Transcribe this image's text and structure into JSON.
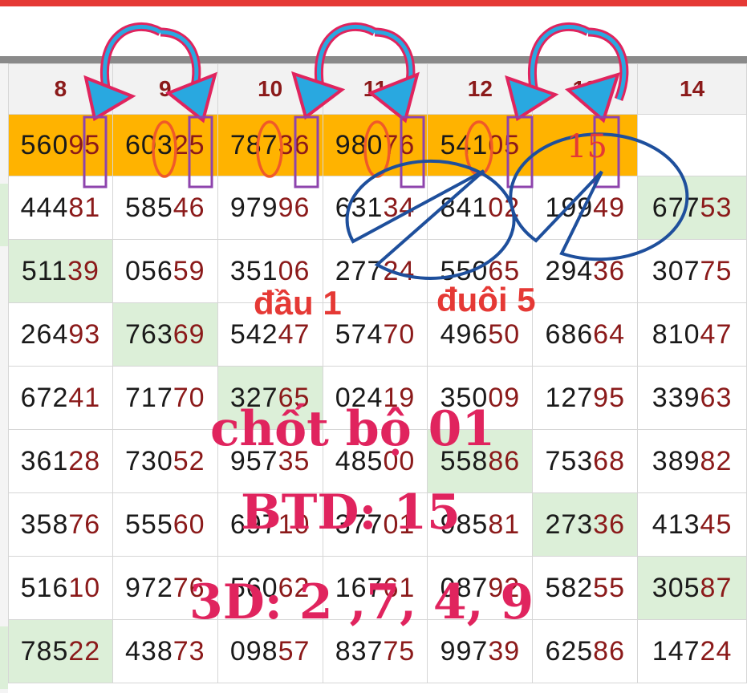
{
  "columns": [
    "8",
    "9",
    "10",
    "11",
    "12",
    "13",
    "14"
  ],
  "prize_row": [
    {
      "head": "560",
      "tail": "95"
    },
    {
      "head": "603",
      "tail": "25"
    },
    {
      "head": "787",
      "tail": "36"
    },
    {
      "head": "980",
      "tail": "76"
    },
    {
      "head": "541",
      "tail": "05"
    },
    {
      "head": "",
      "tail": ""
    },
    {
      "head": "",
      "tail": ""
    }
  ],
  "rows": [
    [
      {
        "head": "444",
        "tail": "81"
      },
      {
        "head": "585",
        "tail": "46"
      },
      {
        "head": "979",
        "tail": "96"
      },
      {
        "head": "631",
        "tail": "34"
      },
      {
        "head": "841",
        "tail": "02"
      },
      {
        "head": "199",
        "tail": "49"
      },
      {
        "head": "677",
        "tail": "53"
      }
    ],
    [
      {
        "head": "511",
        "tail": "39"
      },
      {
        "head": "056",
        "tail": "59"
      },
      {
        "head": "351",
        "tail": "06"
      },
      {
        "head": "277",
        "tail": "24"
      },
      {
        "head": "550",
        "tail": "65"
      },
      {
        "head": "294",
        "tail": "36"
      },
      {
        "head": "307",
        "tail": "75"
      }
    ],
    [
      {
        "head": "264",
        "tail": "93"
      },
      {
        "head": "763",
        "tail": "69"
      },
      {
        "head": "542",
        "tail": "47"
      },
      {
        "head": "574",
        "tail": "70"
      },
      {
        "head": "496",
        "tail": "50"
      },
      {
        "head": "686",
        "tail": "64"
      },
      {
        "head": "810",
        "tail": "47"
      }
    ],
    [
      {
        "head": "672",
        "tail": "41"
      },
      {
        "head": "717",
        "tail": "70"
      },
      {
        "head": "327",
        "tail": "65"
      },
      {
        "head": "024",
        "tail": "19"
      },
      {
        "head": "350",
        "tail": "09"
      },
      {
        "head": "127",
        "tail": "95"
      },
      {
        "head": "339",
        "tail": "63"
      }
    ],
    [
      {
        "head": "361",
        "tail": "28"
      },
      {
        "head": "730",
        "tail": "52"
      },
      {
        "head": "957",
        "tail": "35"
      },
      {
        "head": "485",
        "tail": "00"
      },
      {
        "head": "558",
        "tail": "86"
      },
      {
        "head": "753",
        "tail": "68"
      },
      {
        "head": "389",
        "tail": "82"
      }
    ],
    [
      {
        "head": "358",
        "tail": "76"
      },
      {
        "head": "555",
        "tail": "60"
      },
      {
        "head": "697",
        "tail": "10"
      },
      {
        "head": "377",
        "tail": "01"
      },
      {
        "head": "985",
        "tail": "81"
      },
      {
        "head": "273",
        "tail": "36"
      },
      {
        "head": "413",
        "tail": "45"
      }
    ],
    [
      {
        "head": "516",
        "tail": "10"
      },
      {
        "head": "972",
        "tail": "76"
      },
      {
        "head": "560",
        "tail": "62"
      },
      {
        "head": "167",
        "tail": "61"
      },
      {
        "head": "087",
        "tail": "92"
      },
      {
        "head": "582",
        "tail": "55"
      },
      {
        "head": "305",
        "tail": "87"
      }
    ],
    [
      {
        "head": "785",
        "tail": "22"
      },
      {
        "head": "438",
        "tail": "73"
      },
      {
        "head": "098",
        "tail": "57"
      },
      {
        "head": "837",
        "tail": "75"
      },
      {
        "head": "997",
        "tail": "39"
      },
      {
        "head": "625",
        "tail": "86"
      },
      {
        "head": "147",
        "tail": "24"
      }
    ]
  ],
  "highlighted_cells": [
    [
      0,
      6
    ],
    [
      1,
      0
    ],
    [
      2,
      1
    ],
    [
      3,
      2
    ],
    [
      4,
      4
    ],
    [
      5,
      5
    ],
    [
      6,
      6
    ],
    [
      7,
      0
    ]
  ],
  "annotations": {
    "fifteen": "15",
    "dau": "đầu 1",
    "duoi": "đuôi 5",
    "line1": "chốt bộ 01",
    "line2": "BTD: 15",
    "line3": "3D: 2 ,7, 4, 9"
  },
  "colors": {
    "prize_row": "#ffb300",
    "highlight": "#dcefd8",
    "tail_digits": "#8b1a1a",
    "arrow_fill": "#29a8e0",
    "arrow_outline": "#e0245e",
    "bubble_outline": "#1e4f9c",
    "box_outline": "#8e44ad",
    "oval_outline": "#f05a28",
    "big_text": "#e0245e"
  }
}
